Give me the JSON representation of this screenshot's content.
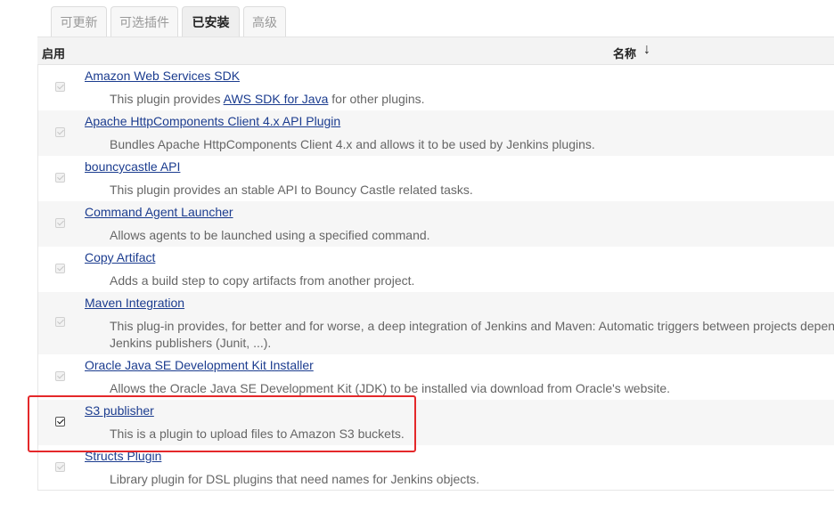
{
  "tabs": [
    "可更新",
    "可选插件",
    "已安装",
    "高级"
  ],
  "table": {
    "col_enabled": "启用",
    "col_name": "名称",
    "sort_arrow": "↓"
  },
  "plugins": [
    {
      "name": "Amazon Web Services SDK",
      "desc_pre": "This plugin provides ",
      "desc_link": "AWS SDK for Java",
      "desc_post": " for other plugins.",
      "checked": false
    },
    {
      "name": "Apache HttpComponents Client 4.x API Plugin",
      "desc": "Bundles Apache HttpComponents Client 4.x and allows it to be used by Jenkins plugins.",
      "checked": false
    },
    {
      "name": "bouncycastle API",
      "desc": "This plugin provides an stable API to Bouncy Castle related tasks.",
      "checked": false
    },
    {
      "name": "Command Agent Launcher",
      "desc": "Allows agents to be launched using a specified command.",
      "checked": false
    },
    {
      "name": "Copy Artifact",
      "desc": "Adds a build step to copy artifacts from another project.",
      "checked": false
    },
    {
      "name": "Maven Integration",
      "desc": "This plug-in provides, for better and for worse, a deep integration of Jenkins and Maven: Automatic triggers between projects depen",
      "desc2": "Jenkins publishers (Junit, ...).",
      "checked": false
    },
    {
      "name": "Oracle Java SE Development Kit Installer",
      "desc": "Allows the Oracle Java SE Development Kit (JDK) to be installed via download from Oracle's website.",
      "checked": false
    },
    {
      "name": "S3 publisher",
      "desc": "This is a plugin to upload files to Amazon S3 buckets.",
      "checked": true
    },
    {
      "name": "Structs Plugin",
      "desc": "Library plugin for DSL plugins that need names for Jenkins objects.",
      "checked": false
    }
  ],
  "colors": {
    "link": "#1b3c8f",
    "highlight": "#e4282a",
    "alt_row": "#f6f6f6"
  }
}
